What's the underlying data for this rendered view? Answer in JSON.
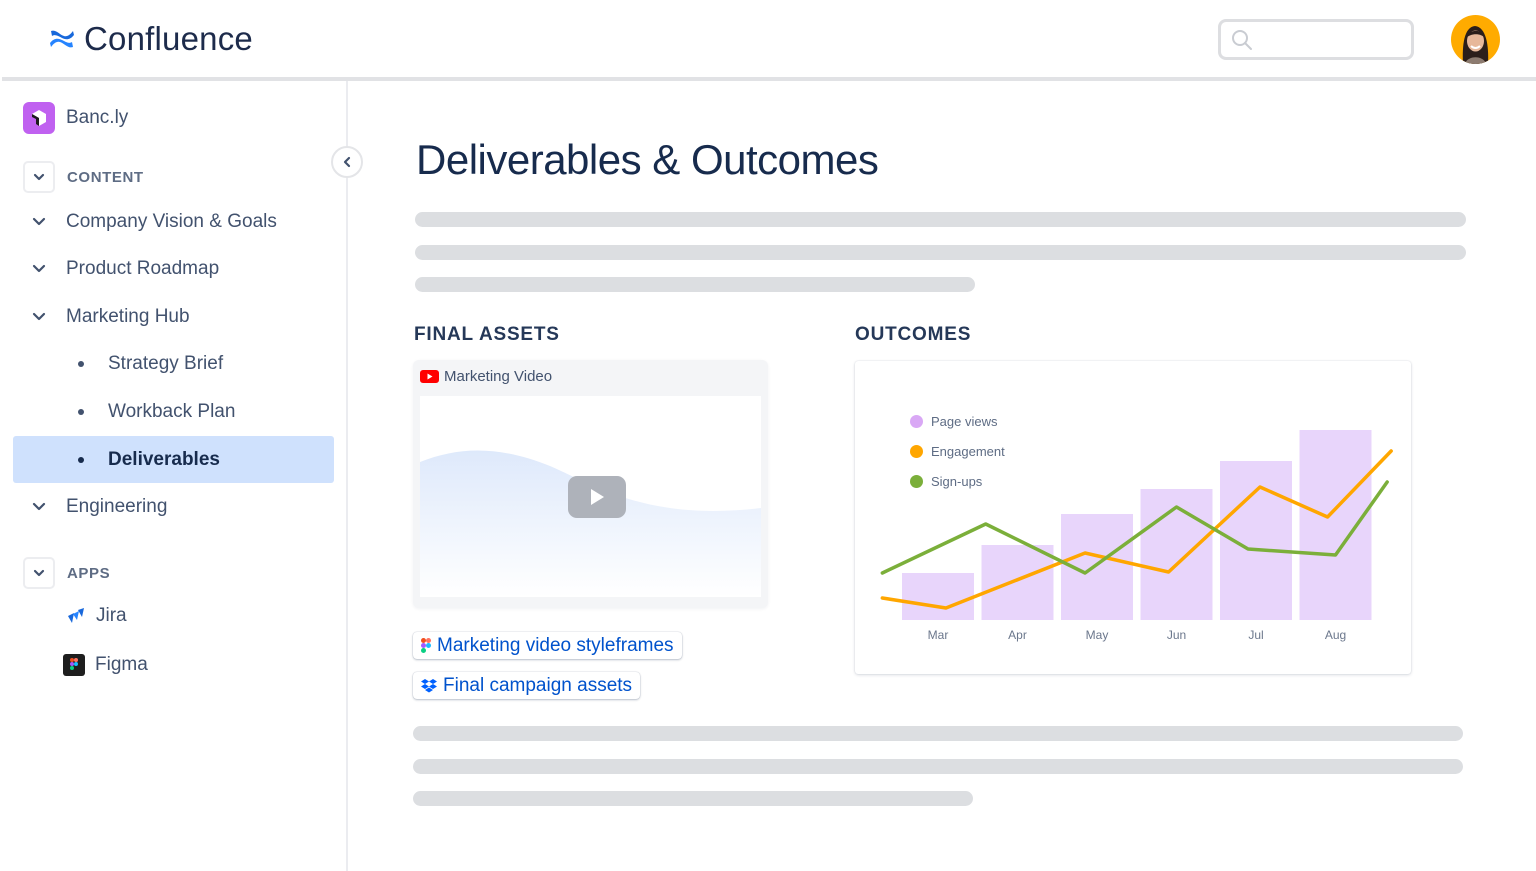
{
  "header": {
    "app_name": "Confluence",
    "search": {
      "placeholder": ""
    },
    "colors": {
      "brand": "#1868DB",
      "avatar_bg": "#FFAB00"
    }
  },
  "sidebar": {
    "space_name": "Banc.ly",
    "sections": [
      {
        "label": "CONTENT"
      },
      {
        "label": "APPS"
      }
    ],
    "content_items": [
      {
        "label": "Company Vision & Goals",
        "type": "parent"
      },
      {
        "label": "Product Roadmap",
        "type": "parent"
      },
      {
        "label": "Marketing Hub",
        "type": "parent"
      },
      {
        "label": "Strategy Brief",
        "type": "child"
      },
      {
        "label": "Workback Plan",
        "type": "child"
      },
      {
        "label": "Deliverables",
        "type": "child",
        "active": true
      },
      {
        "label": "Engineering",
        "type": "parent"
      }
    ],
    "apps": [
      {
        "label": "Jira",
        "icon": "jira-icon"
      },
      {
        "label": "Figma",
        "icon": "figma-icon"
      }
    ]
  },
  "main": {
    "title": "Deliverables & Outcomes",
    "final_assets": {
      "heading": "FINAL ASSETS",
      "video": {
        "title": "Marketing Video",
        "icon": "youtube-icon"
      },
      "links": [
        {
          "label": "Marketing video styleframes",
          "icon": "figma-icon"
        },
        {
          "label": "Final campaign assets",
          "icon": "dropbox-icon"
        }
      ]
    },
    "outcomes": {
      "heading": "OUTCOMES"
    }
  },
  "chart_data": {
    "type": "bar",
    "title": "",
    "xlabel": "",
    "ylabel": "",
    "ylim": [
      0,
      100
    ],
    "grid": false,
    "legend_position": "top-left",
    "categories": [
      "Mar",
      "Apr",
      "May",
      "Jun",
      "Jul",
      "Aug"
    ],
    "series": [
      {
        "name": "Page views",
        "type": "bar",
        "color": "#E8D5FB",
        "legend_color": "#D9A8F5",
        "values": [
          23.5,
          37.5,
          53,
          65.5,
          79.5,
          95
        ]
      },
      {
        "name": "Engagement",
        "type": "line",
        "color": "#FFA600",
        "points": [
          [
            -0.7,
            11
          ],
          [
            0.1,
            6
          ],
          [
            1.85,
            33.5
          ],
          [
            2.9,
            24
          ],
          [
            4.05,
            66.5
          ],
          [
            4.9,
            51.5
          ],
          [
            5.7,
            84.5
          ]
        ]
      },
      {
        "name": "Sign-ups",
        "type": "line",
        "color": "#7BAF3A",
        "points": [
          [
            -0.7,
            23.5
          ],
          [
            0.6,
            48
          ],
          [
            1.85,
            23.5
          ],
          [
            3.0,
            56.5
          ],
          [
            3.9,
            35.5
          ],
          [
            5.0,
            32.5
          ],
          [
            5.65,
            69
          ]
        ]
      }
    ]
  }
}
